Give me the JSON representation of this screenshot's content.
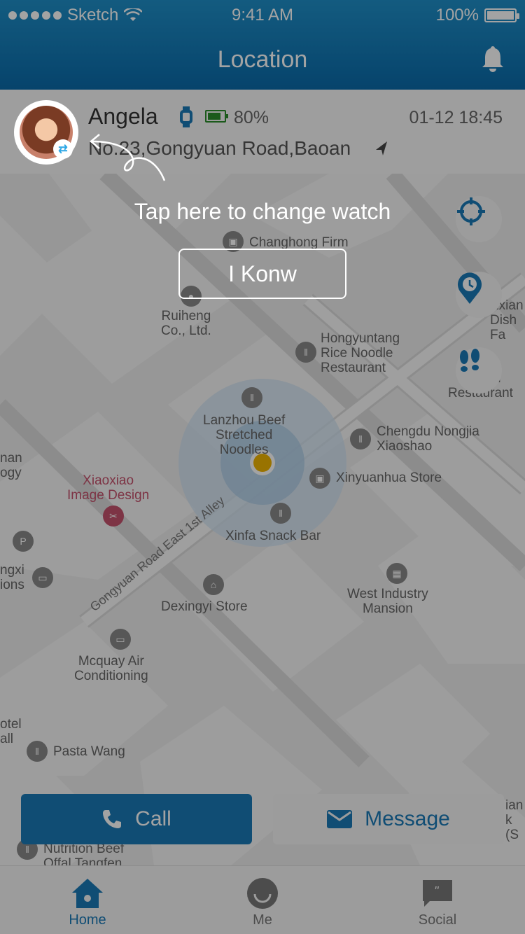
{
  "status_bar": {
    "signal_label": "Sketch",
    "time": "9:41 AM",
    "battery": "100%"
  },
  "nav": {
    "title": "Location"
  },
  "card": {
    "name": "Angela",
    "battery_percent": "80%",
    "datetime": "01-12 18:45",
    "address": "No.23,Gongyuan Road,Baoan"
  },
  "map": {
    "road_label": "Gongyuan Road East 1st Alley",
    "pois": [
      {
        "label": "Changhong Firm"
      },
      {
        "label": "Ruiheng\nCo., Ltd."
      },
      {
        "label": "Hongyuntang\nRice Noodle\nRestaurant"
      },
      {
        "label": "Lanzhou Beef\nStretched\nNoodles"
      },
      {
        "label": "Chengdu Nongjia\nXiaoshao"
      },
      {
        "label": "Xinyuanhua Store"
      },
      {
        "label": "Xiaoxiao\nImage Design"
      },
      {
        "label": "Xinfa Snack Bar"
      },
      {
        "label": "West Industry\nMansion"
      },
      {
        "label": "Dexingyi Store"
      },
      {
        "label": "Mcquay Air\nConditioning"
      },
      {
        "label": "Pasta Wang"
      },
      {
        "label": "Nutrition Beef\nOffal Tangfen"
      },
      {
        "label": "Exian\nDish Fa"
      },
      {
        "label": "Xiaoyu\nRestaurant"
      },
      {
        "label": "nan\nogy"
      },
      {
        "label": "ngxi\nions"
      },
      {
        "label": "otel\nall"
      },
      {
        "label": "ian\nk (S"
      }
    ]
  },
  "actions": {
    "call_label": "Call",
    "message_label": "Message"
  },
  "tabs": [
    {
      "label": "Home"
    },
    {
      "label": "Me"
    },
    {
      "label": "Social"
    }
  ],
  "onboarding": {
    "hint": "Tap here to change watch",
    "button": "I Konw"
  },
  "colors": {
    "brand": "#1a79b6",
    "battery": "#2b8d2b",
    "poi_pink": "#c4526c"
  }
}
